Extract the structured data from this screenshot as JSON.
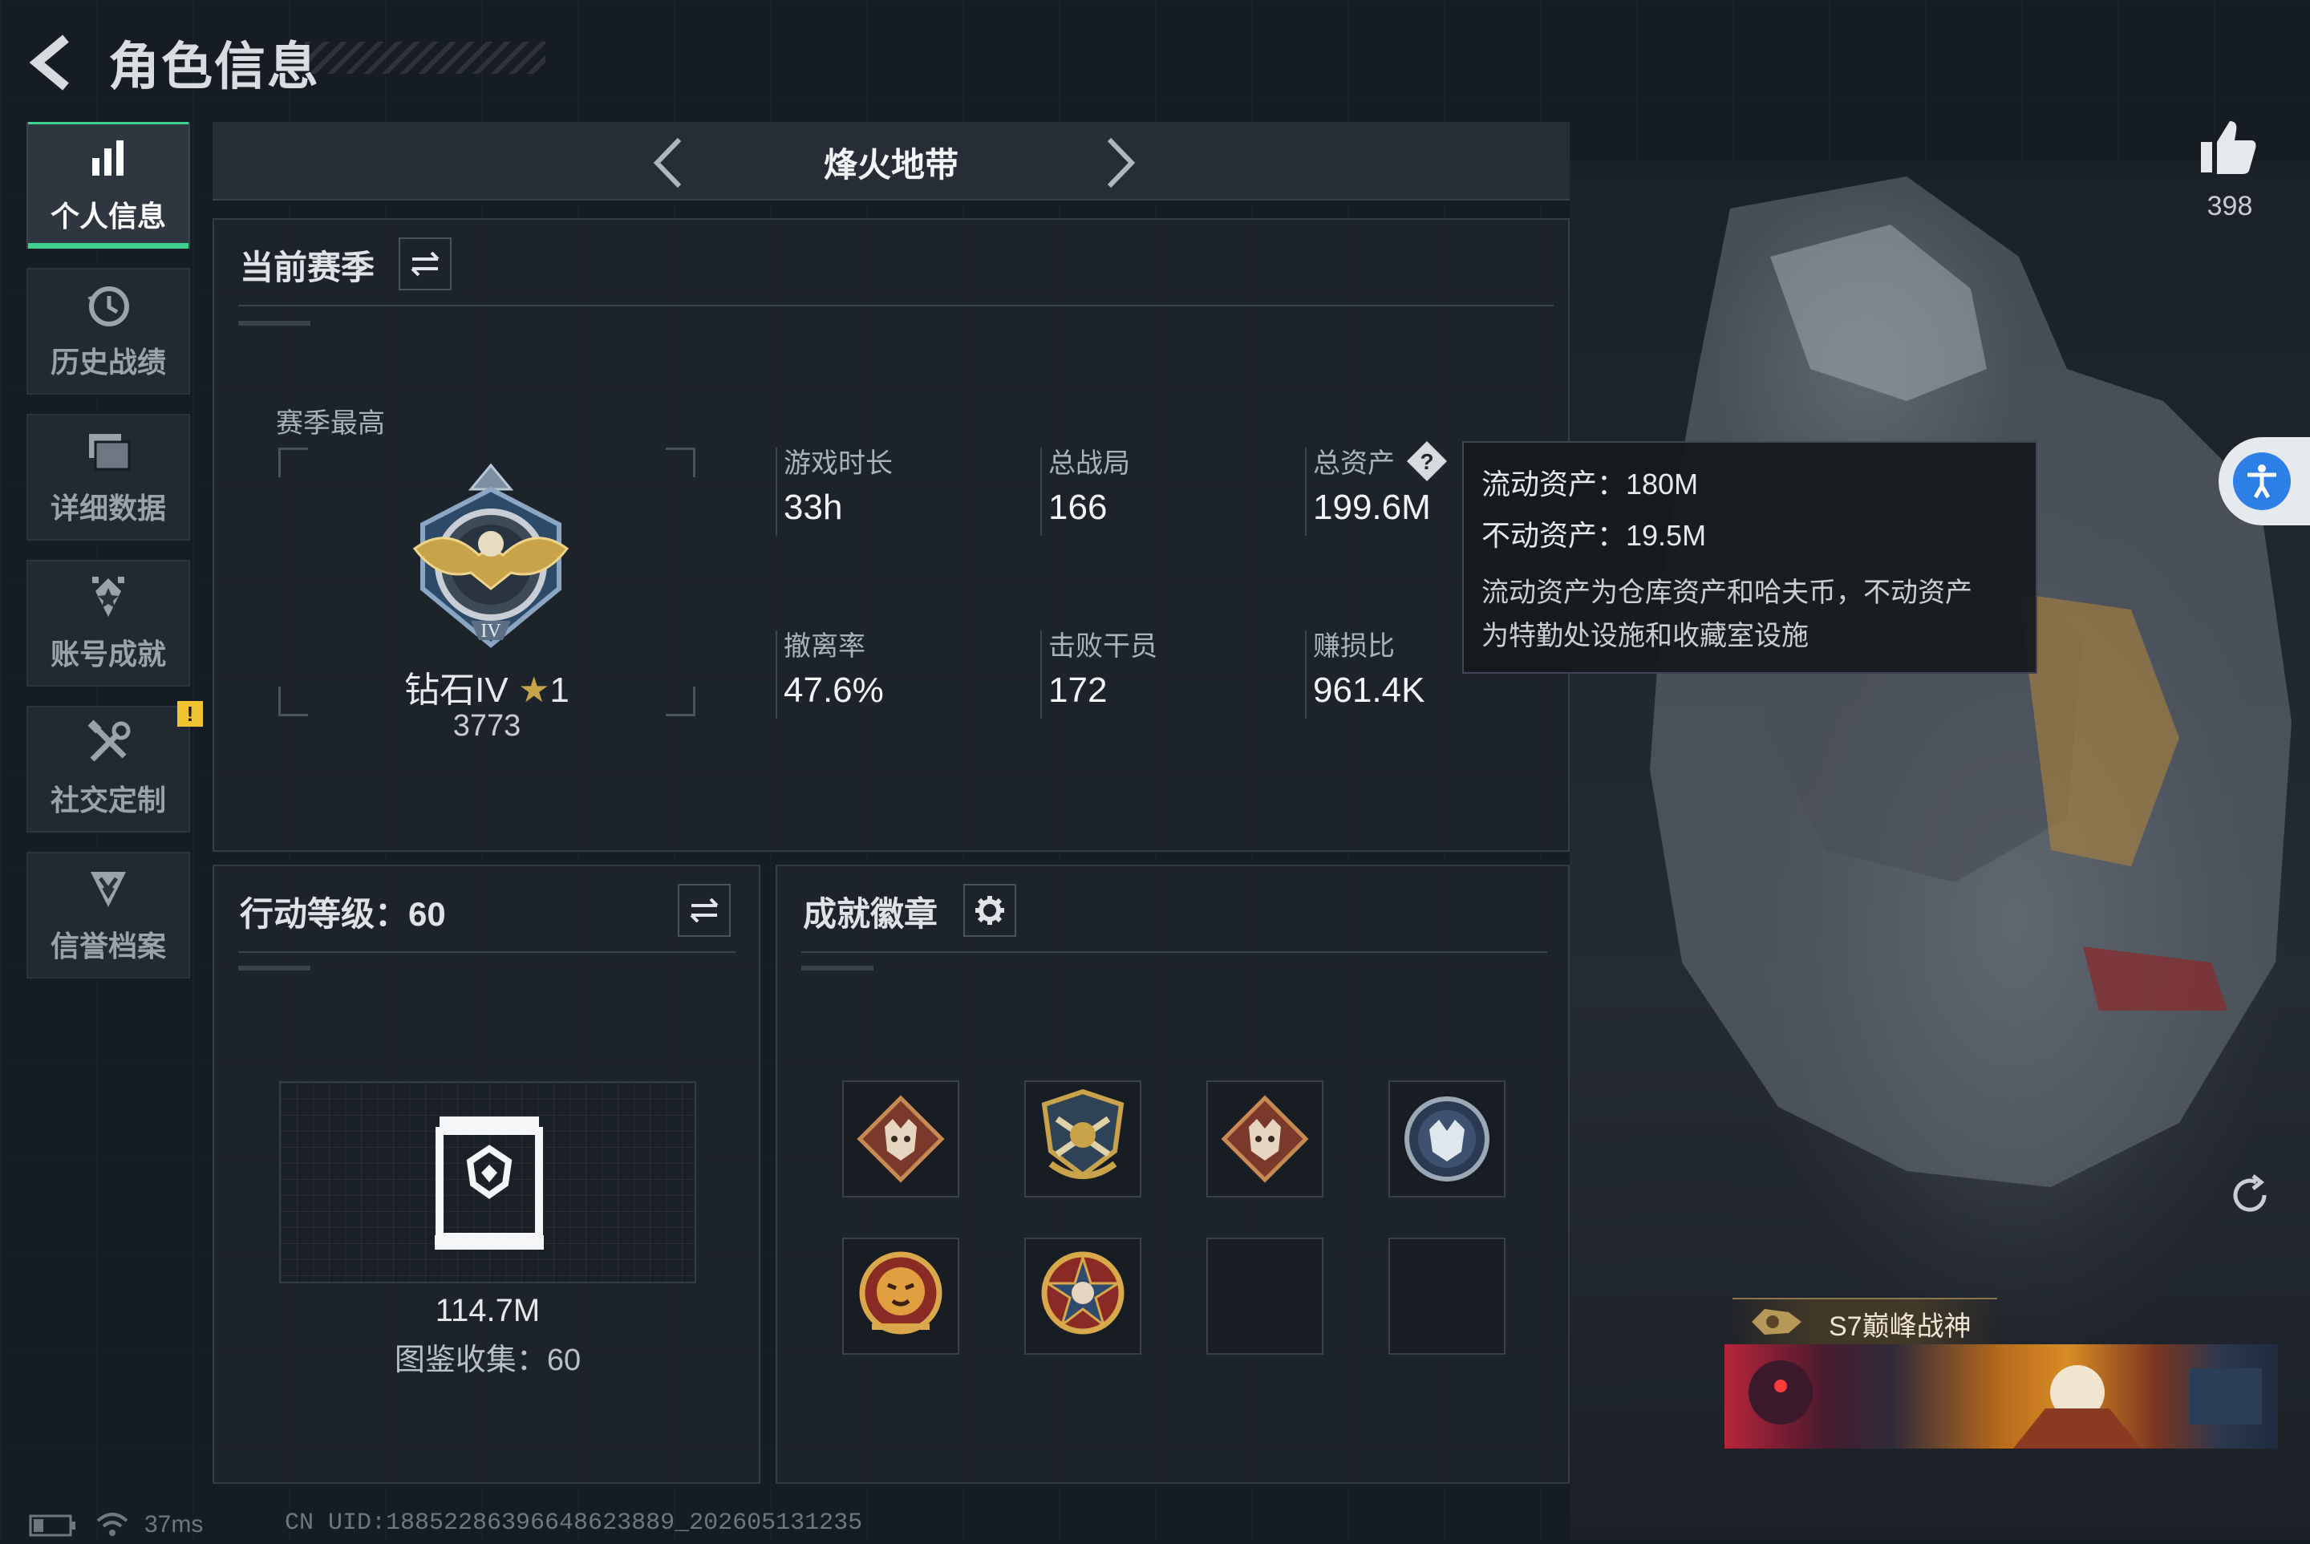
{
  "header": {
    "title": "角色信息"
  },
  "sidebar": {
    "items": [
      {
        "label": "个人信息",
        "icon": "bar-chart-icon",
        "active": true
      },
      {
        "label": "历史战绩",
        "icon": "history-clock-icon"
      },
      {
        "label": "详细数据",
        "icon": "folder-icon"
      },
      {
        "label": "账号成就",
        "icon": "achievement-star-icon"
      },
      {
        "label": "社交定制",
        "icon": "tools-icon",
        "badge": "!"
      },
      {
        "label": "信誉档案",
        "icon": "shield-chevron-icon"
      }
    ]
  },
  "mode_bar": {
    "name": "烽火地带"
  },
  "season_panel": {
    "title": "当前赛季",
    "season_best_label": "赛季最高",
    "rank": {
      "name": "钻石IV",
      "stars": "1",
      "score": "3773"
    },
    "stats": [
      {
        "label": "游戏时长",
        "value": "33h"
      },
      {
        "label": "总战局",
        "value": "166"
      },
      {
        "label": "总资产",
        "value": "199.6M"
      },
      {
        "label": "撤离率",
        "value": "47.6%"
      },
      {
        "label": "击败干员",
        "value": "172"
      },
      {
        "label": "赚损比",
        "value": "961.4K"
      }
    ]
  },
  "tooltip": {
    "liquid": "流动资产：180M",
    "fixed": "不动资产：19.5M",
    "description_line1": "流动资产为仓库资产和哈夫币，不动资产",
    "description_line2": "为特勤处设施和收藏室设施"
  },
  "level_panel": {
    "title": "行动等级：60",
    "codex_value": "114.7M",
    "codex_label": "图鉴收集：60"
  },
  "badge_panel": {
    "title": "成就徽章",
    "badges": [
      "wolf-diamond-badge",
      "crossed-guns-shield-badge",
      "wolf-diamond-badge-2",
      "wolf-round-badge",
      "tiger-round-badge",
      "star-skull-badge",
      "empty-slot",
      "empty-slot"
    ]
  },
  "profile": {
    "likes": "398",
    "title_tag": "S7巅峰战神"
  },
  "status_bar": {
    "ping": "37ms",
    "uid": "CN UID:18852286396648623889_202605131235"
  },
  "colors": {
    "accent_green": "#3fd08f",
    "warning_yellow": "#f2c530",
    "background": "#161c24"
  }
}
